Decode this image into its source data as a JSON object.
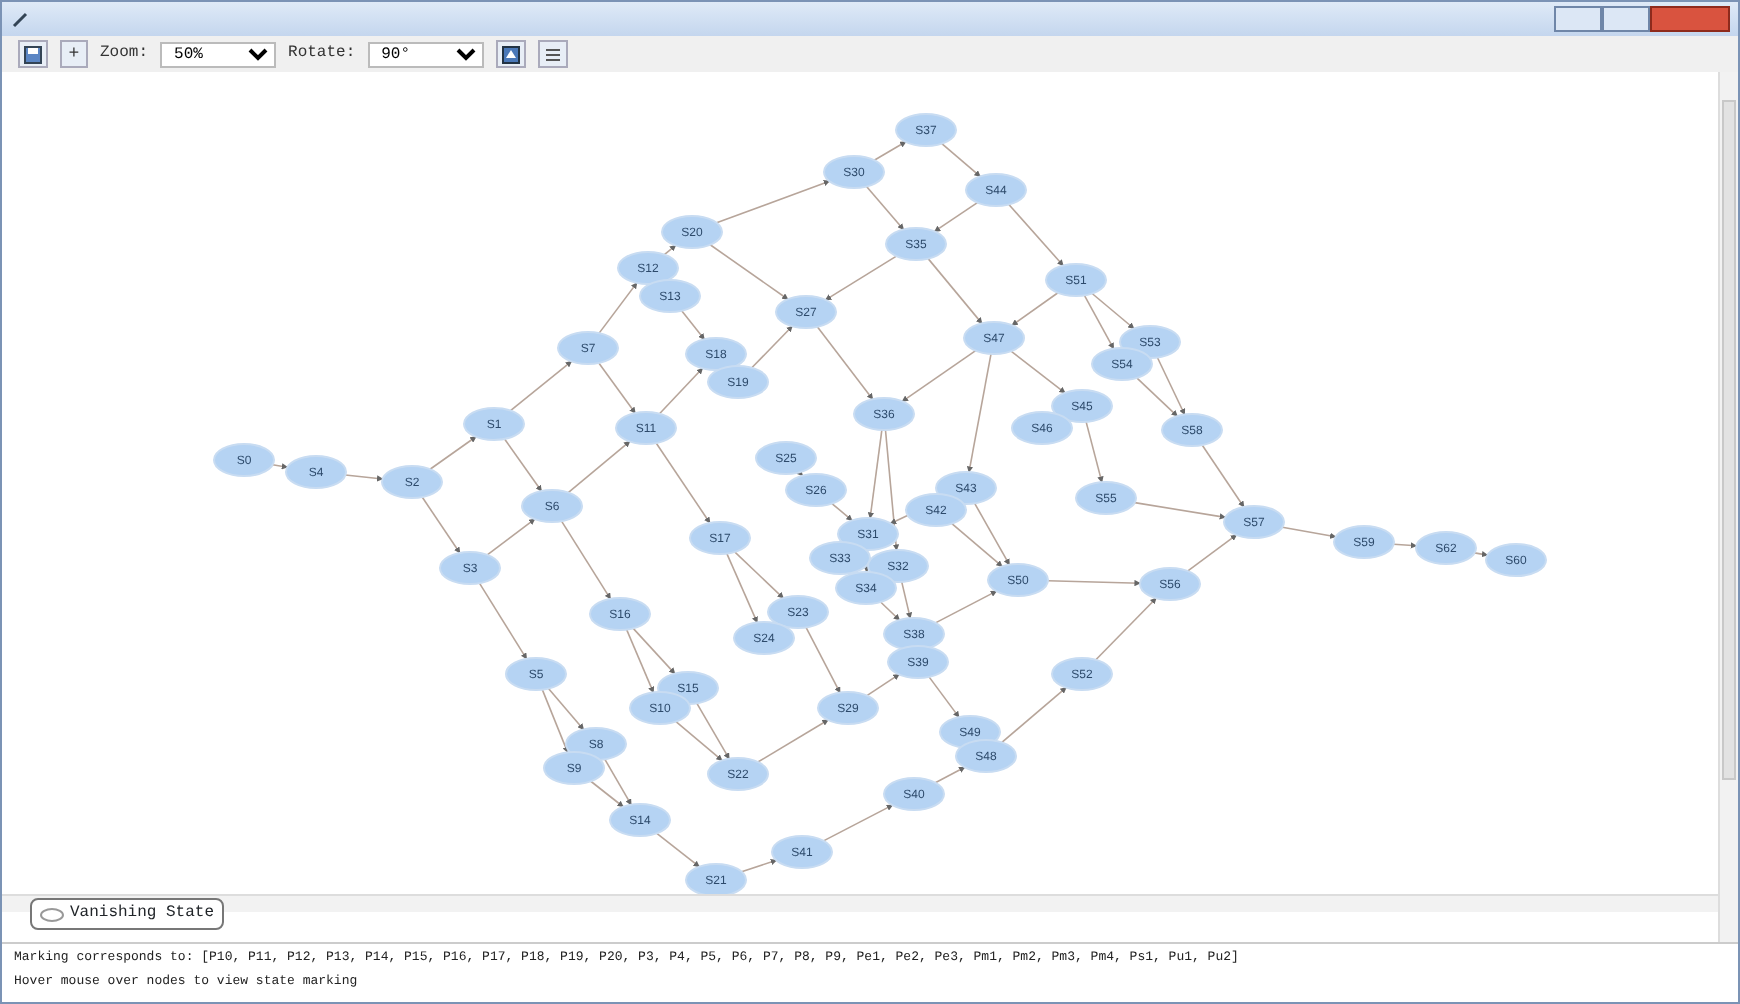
{
  "toolbar": {
    "plus": "+",
    "zoom_label": "Zoom:",
    "zoom_value": "50%",
    "rotate_label": "Rotate:",
    "rotate_value": "90°"
  },
  "graph": {
    "nodes": [
      {
        "label": "S37"
      },
      {
        "label": "S30"
      },
      {
        "label": "S44"
      },
      {
        "label": "S20"
      },
      {
        "label": "S35"
      },
      {
        "label": "S12"
      },
      {
        "label": "S51"
      },
      {
        "label": "S13"
      },
      {
        "label": "S27"
      },
      {
        "label": "S47"
      },
      {
        "label": "S53"
      },
      {
        "label": "S7"
      },
      {
        "label": "S18"
      },
      {
        "label": "S54"
      },
      {
        "label": "S19"
      },
      {
        "label": "S45"
      },
      {
        "label": "S36"
      },
      {
        "label": "S1"
      },
      {
        "label": "S11"
      },
      {
        "label": "S46"
      },
      {
        "label": "S58"
      },
      {
        "label": "S25"
      },
      {
        "label": "S0"
      },
      {
        "label": "S4"
      },
      {
        "label": "S2"
      },
      {
        "label": "S43"
      },
      {
        "label": "S26"
      },
      {
        "label": "S55"
      },
      {
        "label": "S6"
      },
      {
        "label": "S42"
      },
      {
        "label": "S57"
      },
      {
        "label": "S31"
      },
      {
        "label": "S17"
      },
      {
        "label": "S59"
      },
      {
        "label": "S62"
      },
      {
        "label": "S33"
      },
      {
        "label": "S60"
      },
      {
        "label": "S32"
      },
      {
        "label": "S3"
      },
      {
        "label": "S50"
      },
      {
        "label": "S56"
      },
      {
        "label": "S34"
      },
      {
        "label": "S23"
      },
      {
        "label": "S16"
      },
      {
        "label": "S38"
      },
      {
        "label": "S24"
      },
      {
        "label": "S39"
      },
      {
        "label": "S5"
      },
      {
        "label": "S52"
      },
      {
        "label": "S15"
      },
      {
        "label": "S10"
      },
      {
        "label": "S29"
      },
      {
        "label": "S49"
      },
      {
        "label": "S8"
      },
      {
        "label": "S48"
      },
      {
        "label": "S9"
      },
      {
        "label": "S22"
      },
      {
        "label": "S40"
      },
      {
        "label": "S14"
      },
      {
        "label": "S41"
      },
      {
        "label": "S21"
      }
    ]
  },
  "legend": {
    "label": "Vanishing State"
  },
  "status_lines": [
    "Marking corresponds to: [P10, P11, P12, P13, P14, P15, P16, P17, P18, P19, P20, P3, P4, P5, P6, P7, P8, P9, Pe1, Pe2, Pe3, Pm1, Pm2, Pm3, Pm4, Ps1, Pu1, Pu2]",
    "Hover mouse over nodes to view state marking"
  ]
}
